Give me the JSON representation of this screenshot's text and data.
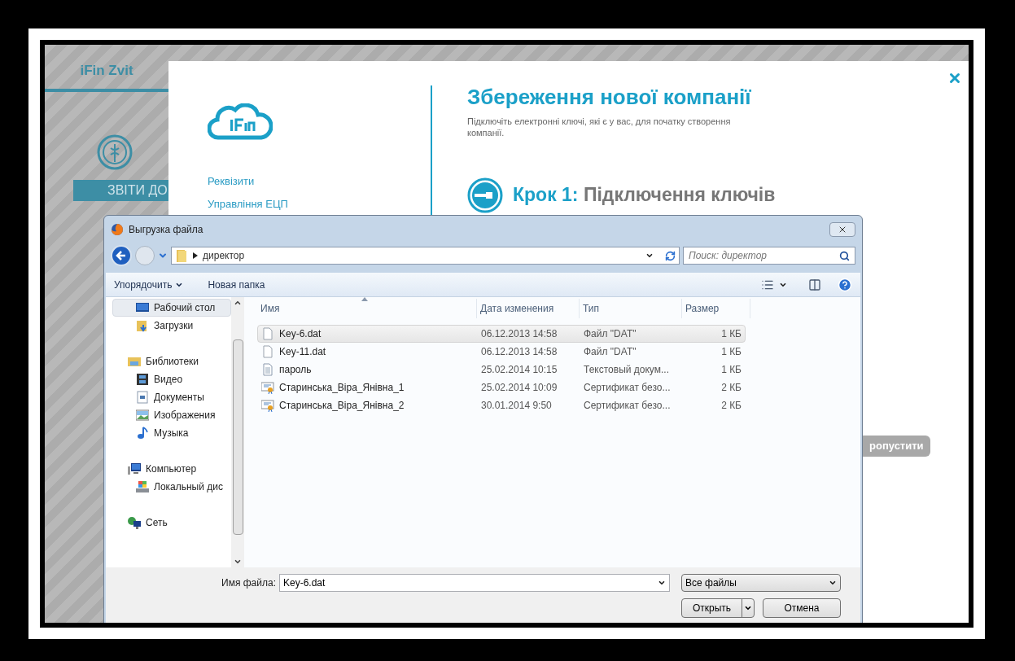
{
  "app": {
    "brand": "iFin Zvit",
    "section_button": "ЗВІТИ ДО"
  },
  "modal": {
    "menu": [
      "Реквізити",
      "Управління ЕЦП"
    ],
    "title": "Збереження нової компанії",
    "subtitle": "Підключіть електронні ключі, які є у вас, для початку створення компанії.",
    "step_label": "Крок 1:",
    "step_text": "Підключення ключів",
    "skip_button": "ропустити"
  },
  "dialog": {
    "title": "Выгрузка файла",
    "path": "директор",
    "search_placeholder": "Поиск: директор",
    "toolbar": [
      {
        "label": "Упорядочить",
        "dropdown": true
      },
      {
        "label": "Новая папка",
        "dropdown": false
      }
    ],
    "nav": [
      {
        "label": "Рабочий стол",
        "kind": "desktop",
        "selected": true
      },
      {
        "label": "Загрузки",
        "kind": "downloads",
        "selected": false
      },
      {
        "label": "Библиотеки",
        "kind": "library",
        "selected": false,
        "children": [
          {
            "label": "Видео",
            "kind": "video",
            "selected": false
          },
          {
            "label": "Документы",
            "kind": "document",
            "selected": false
          },
          {
            "label": "Изображения",
            "kind": "image",
            "selected": false
          },
          {
            "label": "Музыка",
            "kind": "music",
            "selected": false
          }
        ]
      },
      {
        "label": "Компьютер",
        "kind": "computer",
        "selected": false,
        "children": [
          {
            "label": "Локальный дис",
            "kind": "disk",
            "selected": false
          }
        ]
      },
      {
        "label": "Сеть",
        "kind": "network",
        "selected": false
      }
    ],
    "columns": [
      "Имя",
      "Дата изменения",
      "Тип",
      "Размер"
    ],
    "files": [
      {
        "name": "Key-6.dat",
        "date": "06.12.2013 14:58",
        "type": "Файл \"DAT\"",
        "size": "1 КБ",
        "kind": "blank",
        "selected": true
      },
      {
        "name": "Key-11.dat",
        "date": "06.12.2013 14:58",
        "type": "Файл \"DAT\"",
        "size": "1 КБ",
        "kind": "blank",
        "selected": false
      },
      {
        "name": "пароль",
        "date": "25.02.2014 10:15",
        "type": "Текстовый докум...",
        "size": "1 КБ",
        "kind": "text",
        "selected": false
      },
      {
        "name": "Старинська_Віра_Янівна_1",
        "date": "25.02.2014 10:09",
        "type": "Сертификат безо...",
        "size": "2 КБ",
        "kind": "cert",
        "selected": false
      },
      {
        "name": "Старинська_Віра_Янівна_2",
        "date": "30.01.2014 9:50",
        "type": "Сертификат безо...",
        "size": "2 КБ",
        "kind": "cert",
        "selected": false
      }
    ],
    "filename_label": "Имя файла:",
    "filename": "Key-6.dat",
    "filter": "Все файлы",
    "open_button": "Открыть",
    "cancel_button": "Отмена"
  }
}
